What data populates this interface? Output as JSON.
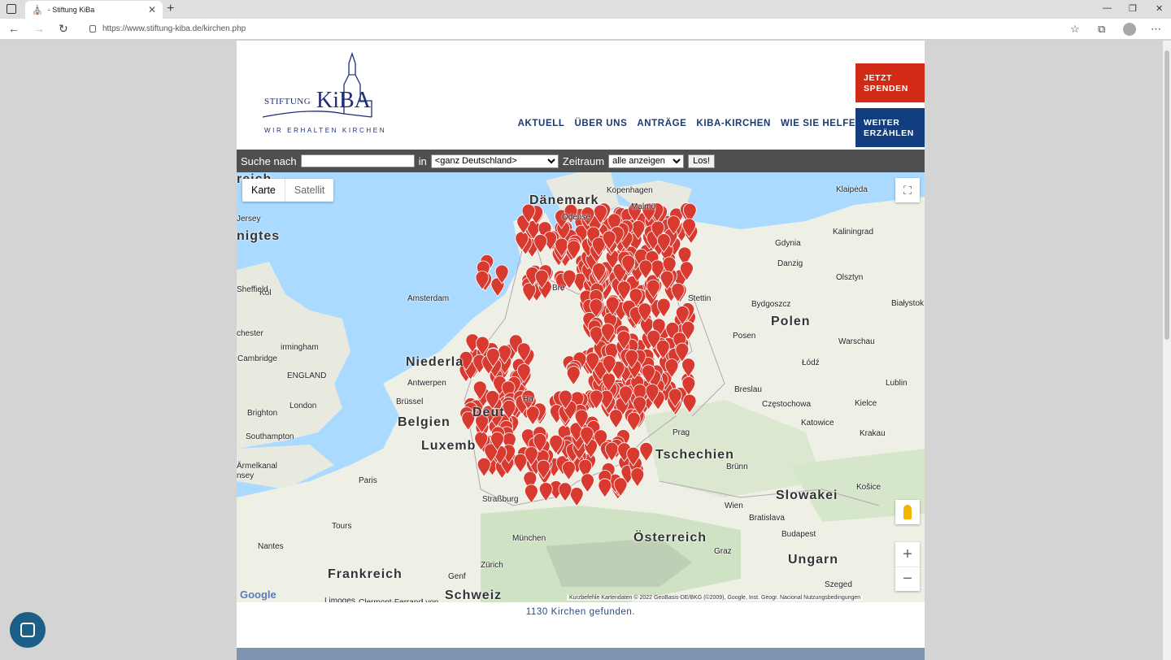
{
  "browser": {
    "tab_title": "- Stiftung KiBa",
    "url": "https://www.stiftung-kiba.de/kirchen.php"
  },
  "logo": {
    "stiftung": "STIFTUNG",
    "kiba": "KiBA",
    "tagline": "WIR ERHALTEN KIRCHEN"
  },
  "nav": {
    "items": [
      "AKTUELL",
      "ÜBER UNS",
      "ANTRÄGE",
      "KIBA-KIRCHEN",
      "WIE SIE HELFEN"
    ]
  },
  "search": {
    "label_search": "Suche nach",
    "query": "",
    "label_in": "in",
    "region_selected": "<ganz Deutschland>",
    "label_period": "Zeitraum",
    "period_selected": "alle anzeigen",
    "submit": "Los!"
  },
  "map": {
    "type_map": "Karte",
    "type_satellite": "Satellit",
    "labels": [
      {
        "text": "Dänemark",
        "kind": "country"
      },
      {
        "text": "Kopenhagen",
        "kind": "city"
      },
      {
        "text": "Malmö",
        "kind": "city"
      },
      {
        "text": "Odense",
        "kind": "city"
      },
      {
        "text": "Klaipėda",
        "kind": "city"
      },
      {
        "text": "Kaliningrad",
        "kind": "city"
      },
      {
        "text": "Gdynia",
        "kind": "city"
      },
      {
        "text": "Danzig",
        "kind": "city"
      },
      {
        "text": "Olsztyn",
        "kind": "city"
      },
      {
        "text": "Stettin",
        "kind": "city"
      },
      {
        "text": "Bydgoszcz",
        "kind": "city"
      },
      {
        "text": "Białystok",
        "kind": "city"
      },
      {
        "text": "Polen",
        "kind": "country"
      },
      {
        "text": "Posen",
        "kind": "city"
      },
      {
        "text": "Warschau",
        "kind": "city"
      },
      {
        "text": "Łódź",
        "kind": "city"
      },
      {
        "text": "Lublin",
        "kind": "city"
      },
      {
        "text": "Breslau",
        "kind": "city"
      },
      {
        "text": "Częstochowa",
        "kind": "city"
      },
      {
        "text": "Kielce",
        "kind": "city"
      },
      {
        "text": "Katowice",
        "kind": "city"
      },
      {
        "text": "Krakau",
        "kind": "city"
      },
      {
        "text": "Prag",
        "kind": "city"
      },
      {
        "text": "Tschechien",
        "kind": "country"
      },
      {
        "text": "Brünn",
        "kind": "city"
      },
      {
        "text": "Slowakei",
        "kind": "country"
      },
      {
        "text": "Košice",
        "kind": "city"
      },
      {
        "text": "Wien",
        "kind": "city"
      },
      {
        "text": "Bratislava",
        "kind": "city"
      },
      {
        "text": "Budapest",
        "kind": "city"
      },
      {
        "text": "Ungarn",
        "kind": "country"
      },
      {
        "text": "Szeged",
        "kind": "city"
      },
      {
        "text": "Österreich",
        "kind": "country"
      },
      {
        "text": "Graz",
        "kind": "city"
      },
      {
        "text": "München",
        "kind": "city"
      },
      {
        "text": "Zürich",
        "kind": "city"
      },
      {
        "text": "Schweiz",
        "kind": "country"
      },
      {
        "text": "Genf",
        "kind": "city"
      },
      {
        "text": "Frankreich",
        "kind": "country"
      },
      {
        "text": "Limoges",
        "kind": "city"
      },
      {
        "text": "Clermont-Ferrand",
        "kind": "city"
      },
      {
        "text": "Lyon",
        "kind": "city"
      },
      {
        "text": "Nantes",
        "kind": "city"
      },
      {
        "text": "Tours",
        "kind": "city"
      },
      {
        "text": "Paris",
        "kind": "city"
      },
      {
        "text": "Straßburg",
        "kind": "city"
      },
      {
        "text": "Luxemb",
        "kind": "country"
      },
      {
        "text": "Belgien",
        "kind": "country"
      },
      {
        "text": "Brüssel",
        "kind": "city"
      },
      {
        "text": "Antwerpen",
        "kind": "city"
      },
      {
        "text": "Niederla",
        "kind": "country"
      },
      {
        "text": "Amsterdam",
        "kind": "city"
      },
      {
        "text": "Bre",
        "kind": "city"
      },
      {
        "text": "Ha",
        "kind": "city"
      },
      {
        "text": "Deut",
        "kind": "country"
      },
      {
        "text": "Köl",
        "kind": "city"
      },
      {
        "text": "Sheffield",
        "kind": "city"
      },
      {
        "text": "chester",
        "kind": "city"
      },
      {
        "text": "irmingham",
        "kind": "city"
      },
      {
        "text": "Cambridge",
        "kind": "city"
      },
      {
        "text": "ENGLAND",
        "kind": "city"
      },
      {
        "text": "London",
        "kind": "city"
      },
      {
        "text": "Brighton",
        "kind": "city"
      },
      {
        "text": "Southampton",
        "kind": "city"
      },
      {
        "text": "Ärmelkanal",
        "kind": "city"
      },
      {
        "text": "nsey",
        "kind": "city"
      },
      {
        "text": "Jersey",
        "kind": "city"
      },
      {
        "text": "nigtes",
        "kind": "country"
      },
      {
        "text": "reich",
        "kind": "country"
      }
    ],
    "attribution": "Kurzbefehle   Kartendaten © 2022 GeoBasis-DE/BKG (©2009), Google, Inst. Geogr. Nacional   Nutzungsbedingungen",
    "google": "Google",
    "zoom_in": "+",
    "zoom_out": "−"
  },
  "cta": {
    "donate_line1": "JETZT",
    "donate_line2": "SPENDEN",
    "share_line1": "WEITER",
    "share_line2": "ERZÄHLEN"
  },
  "result_count": "1130 Kirchen gefunden.",
  "colors": {
    "brand_blue": "#1c3a6e",
    "donate_red": "#d12a16",
    "share_blue": "#123e80",
    "marker_red": "#d93a30"
  }
}
